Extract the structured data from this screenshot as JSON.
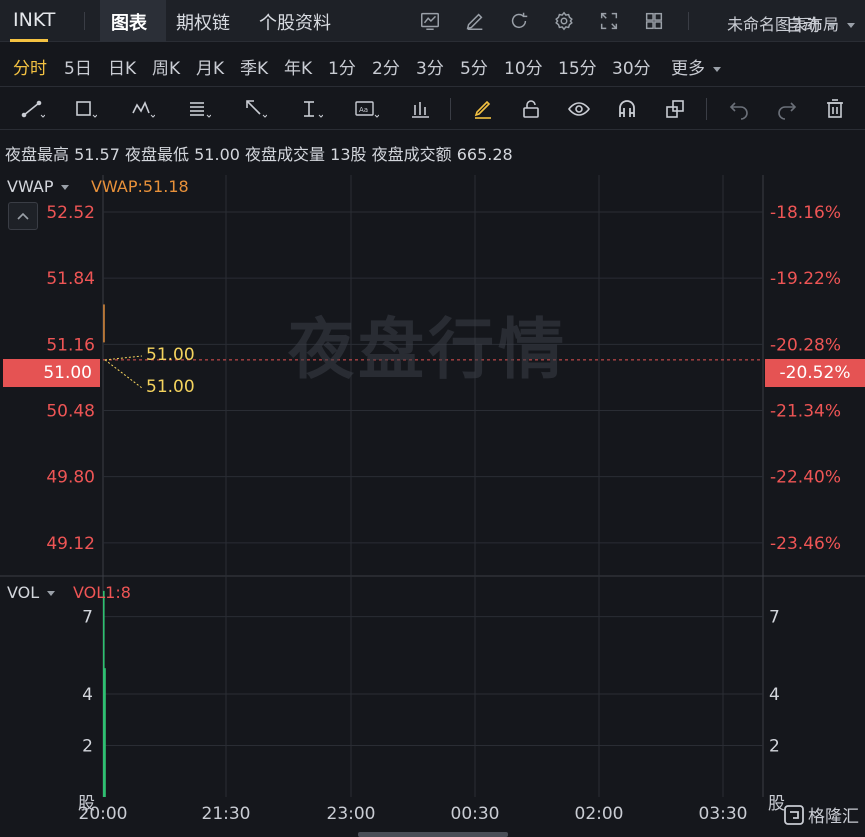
{
  "header": {
    "ticker": "INKT",
    "tabs": [
      {
        "label": "图表",
        "active": true
      },
      {
        "label": "期权链",
        "active": false
      },
      {
        "label": "个股资料",
        "active": false
      }
    ],
    "icons": [
      "chart-indicator-icon",
      "edit-pen-icon",
      "refresh-icon",
      "settings-gear-icon",
      "fullscreen-icon",
      "grid-layout-icon"
    ],
    "layout_name": "未命名图表布局"
  },
  "periods": {
    "items": [
      "分时",
      "5日",
      "日K",
      "周K",
      "月K",
      "季K",
      "年K",
      "1分",
      "2分",
      "3分",
      "5分",
      "10分",
      "15分",
      "30分",
      "更多"
    ],
    "active": "分时",
    "scale_mode": "自动"
  },
  "drawing_tools": [
    "trendline-icon",
    "rectangle-icon",
    "pattern-icon",
    "fibonacci-icon",
    "arrow-icon",
    "text-cursor-icon",
    "text-label-icon",
    "bar-pattern-icon",
    "highlighter-icon",
    "lock-icon",
    "eye-icon",
    "magnet-icon",
    "clone-icon",
    "undo-icon",
    "redo-icon",
    "trash-icon"
  ],
  "info": {
    "high_label": "夜盘最高",
    "high": "51.57",
    "low_label": "夜盘最低",
    "low": "51.00",
    "volume_label": "夜盘成交量",
    "volume": "13股",
    "amount_label": "夜盘成交额",
    "amount": "665.28"
  },
  "indicator": {
    "name": "VWAP",
    "value_text": "VWAP:51.18"
  },
  "volume_indicator": {
    "name": "VOL",
    "value_text": "VOL1:8"
  },
  "watermark": "夜盘行情",
  "current_price": "51.00",
  "current_change": "-20.52%",
  "callouts": {
    "upper": "51.00",
    "lower": "51.00"
  },
  "colors": {
    "up": "#ee5555",
    "volume_bar": "#2fbf71",
    "accent": "#f4c242",
    "vwap": "#e8913a",
    "background": "#15171c"
  },
  "chart_data": [
    {
      "type": "line",
      "title": "",
      "y_ticks_left": [
        "52.52",
        "51.84",
        "51.16",
        "50.48",
        "49.80",
        "49.12"
      ],
      "y_ticks_right": [
        "-18.16%",
        "-19.22%",
        "-20.28%",
        "-21.34%",
        "-22.40%",
        "-23.46%"
      ],
      "ylim": [
        48.8,
        52.9
      ],
      "series": [
        {
          "name": "VWAP",
          "x": [
            "20:00",
            "20:00"
          ],
          "values": [
            51.57,
            51.18
          ]
        }
      ],
      "last_price": 51.0
    },
    {
      "type": "bar",
      "title": "",
      "y_ticks_left": [
        "7",
        "4",
        "2"
      ],
      "y_ticks_right": [
        "7",
        "4",
        "2"
      ],
      "unit_label": "股",
      "ylim": [
        0,
        8.5
      ],
      "categories": [
        "20:00",
        "20:00"
      ],
      "values": [
        8,
        5
      ]
    }
  ],
  "x_axis": [
    "20:00",
    "21:30",
    "23:00",
    "00:30",
    "02:00",
    "03:30"
  ],
  "branding": "格隆汇"
}
